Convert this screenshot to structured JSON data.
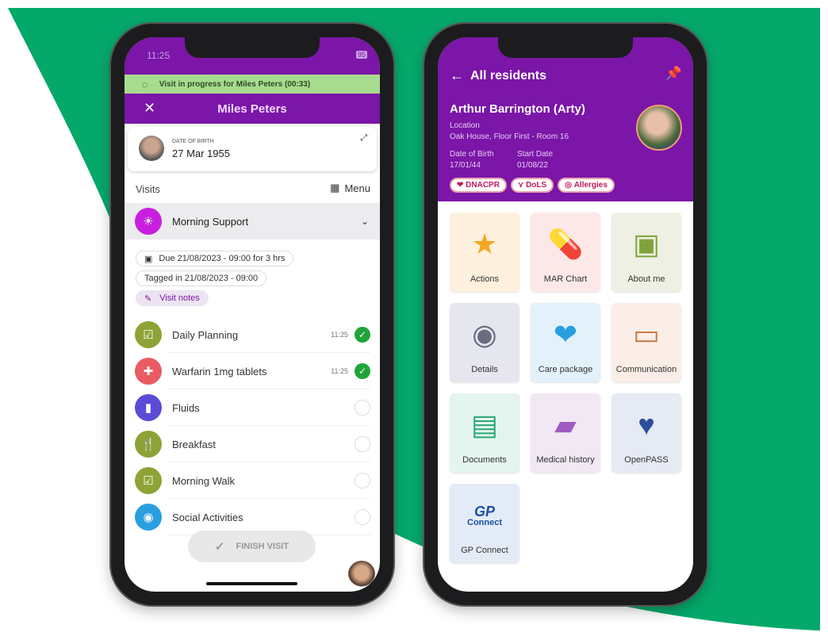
{
  "colors": {
    "brand_purple": "#7b16a8",
    "green_bg": "#05a86b",
    "banner_green": "#a7dc8f",
    "check_green": "#22a33a"
  },
  "left": {
    "status_time": "11:25",
    "battery": "95",
    "banner": "Visit in progress for Miles Peters (00:33)",
    "title": "Miles Peters",
    "dob_label": "DATE OF BIRTH",
    "dob": "27 Mar 1955",
    "visits_label": "Visits",
    "menu_label": "Menu",
    "visit_name": "Morning Support",
    "due": "Due 21/08/2023 - 09:00 for 3 hrs",
    "tagged": "Tagged in 21/08/2023 - 09:00",
    "notes": "Visit notes",
    "tasks": [
      {
        "label": "Daily Planning",
        "time": "11:25",
        "done": true,
        "icon": "clipboard-check-icon",
        "color": "#8ea336"
      },
      {
        "label": "Warfarin 1mg tablets",
        "time": "11:25",
        "done": true,
        "icon": "medical-kit-icon",
        "color": "#e85c62"
      },
      {
        "label": "Fluids",
        "time": "",
        "done": false,
        "icon": "glass-icon",
        "color": "#5b4bd6"
      },
      {
        "label": "Breakfast",
        "time": "",
        "done": false,
        "icon": "cutlery-icon",
        "color": "#8ea336"
      },
      {
        "label": "Morning Walk",
        "time": "",
        "done": false,
        "icon": "clipboard-check-icon",
        "color": "#8ea336"
      },
      {
        "label": "Social Activities",
        "time": "",
        "done": false,
        "icon": "eye-icon",
        "color": "#2a9fe0"
      }
    ],
    "finish": "FINISH VISIT"
  },
  "right": {
    "back_label": "All residents",
    "name": "Arthur Barrington (Arty)",
    "location_label": "Location",
    "location": "Oak House, Floor First - Room 16",
    "dob_label": "Date of Birth",
    "dob": "17/01/44",
    "start_label": "Start Date",
    "start": "01/08/22",
    "badges": [
      "DNACPR",
      "DoLS",
      "Allergies"
    ],
    "tiles": [
      {
        "label": "Actions",
        "icon": "star-icon"
      },
      {
        "label": "MAR Chart",
        "icon": "pills-icon"
      },
      {
        "label": "About me",
        "icon": "id-badge-icon"
      },
      {
        "label": "Details",
        "icon": "user-circle-icon"
      },
      {
        "label": "Care package",
        "icon": "heart-hand-icon"
      },
      {
        "label": "Communication",
        "icon": "chat-icon"
      },
      {
        "label": "Documents",
        "icon": "documents-icon"
      },
      {
        "label": "Medical history",
        "icon": "folder-plus-icon"
      },
      {
        "label": "OpenPASS",
        "icon": "heart-square-icon"
      },
      {
        "label": "GP Connect",
        "icon": "gp-connect-icon",
        "logo": "GP",
        "logo_sub": "Connect"
      }
    ]
  }
}
